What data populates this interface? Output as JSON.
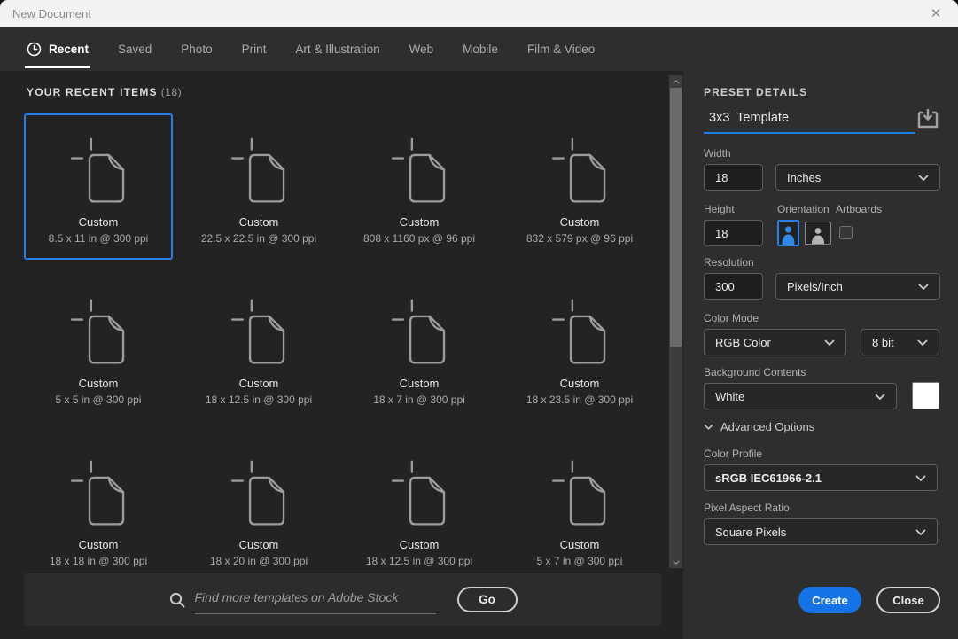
{
  "window": {
    "title": "New Document",
    "close_glyph": "✕"
  },
  "tabs": [
    {
      "label": "Recent",
      "active": true,
      "icon": "clock"
    },
    {
      "label": "Saved",
      "active": false
    },
    {
      "label": "Photo",
      "active": false
    },
    {
      "label": "Print",
      "active": false
    },
    {
      "label": "Art & Illustration",
      "active": false
    },
    {
      "label": "Web",
      "active": false
    },
    {
      "label": "Mobile",
      "active": false
    },
    {
      "label": "Film & Video",
      "active": false
    }
  ],
  "recent": {
    "heading": "YOUR RECENT ITEMS",
    "count": "(18)",
    "items": [
      {
        "name": "Custom",
        "dims": "8.5 x 11 in @ 300 ppi",
        "selected": true
      },
      {
        "name": "Custom",
        "dims": "22.5 x 22.5 in @ 300 ppi",
        "selected": false
      },
      {
        "name": "Custom",
        "dims": "808 x 1160 px @ 96 ppi",
        "selected": false
      },
      {
        "name": "Custom",
        "dims": "832 x 579 px @ 96 ppi",
        "selected": false
      },
      {
        "name": "Custom",
        "dims": "5 x 5 in @ 300 ppi",
        "selected": false
      },
      {
        "name": "Custom",
        "dims": "18 x 12.5 in @ 300 ppi",
        "selected": false
      },
      {
        "name": "Custom",
        "dims": "18 x 7 in @ 300 ppi",
        "selected": false
      },
      {
        "name": "Custom",
        "dims": "18 x 23.5 in @ 300 ppi",
        "selected": false
      },
      {
        "name": "Custom",
        "dims": "18 x 18 in @ 300 ppi",
        "selected": false
      },
      {
        "name": "Custom",
        "dims": "18 x 20 in @ 300 ppi",
        "selected": false
      },
      {
        "name": "Custom",
        "dims": "18 x 12.5 in @ 300 ppi",
        "selected": false
      },
      {
        "name": "Custom",
        "dims": "5 x 7 in @ 300 ppi",
        "selected": false
      }
    ]
  },
  "search": {
    "placeholder": "Find more templates on Adobe Stock",
    "go_label": "Go"
  },
  "preset": {
    "heading": "PRESET DETAILS",
    "name_value": "3x3  Template",
    "width_label": "Width",
    "width_value": "18",
    "width_unit": "Inches",
    "height_label": "Height",
    "height_value": "18",
    "orientation_label": "Orientation",
    "artboards_label": "Artboards",
    "resolution_label": "Resolution",
    "resolution_value": "300",
    "resolution_unit": "Pixels/Inch",
    "color_mode_label": "Color Mode",
    "color_mode_value": "RGB Color",
    "bit_depth_value": "8 bit",
    "background_label": "Background Contents",
    "background_value": "White",
    "advanced_label": "Advanced Options",
    "color_profile_label": "Color Profile",
    "color_profile_value": "sRGB IEC61966-2.1",
    "pixel_aspect_label": "Pixel Aspect Ratio",
    "pixel_aspect_value": "Square Pixels",
    "create_label": "Create",
    "close_label": "Close"
  },
  "colors": {
    "accent": "#1473e6",
    "selection": "#2680eb",
    "background_swatch": "#ffffff"
  }
}
